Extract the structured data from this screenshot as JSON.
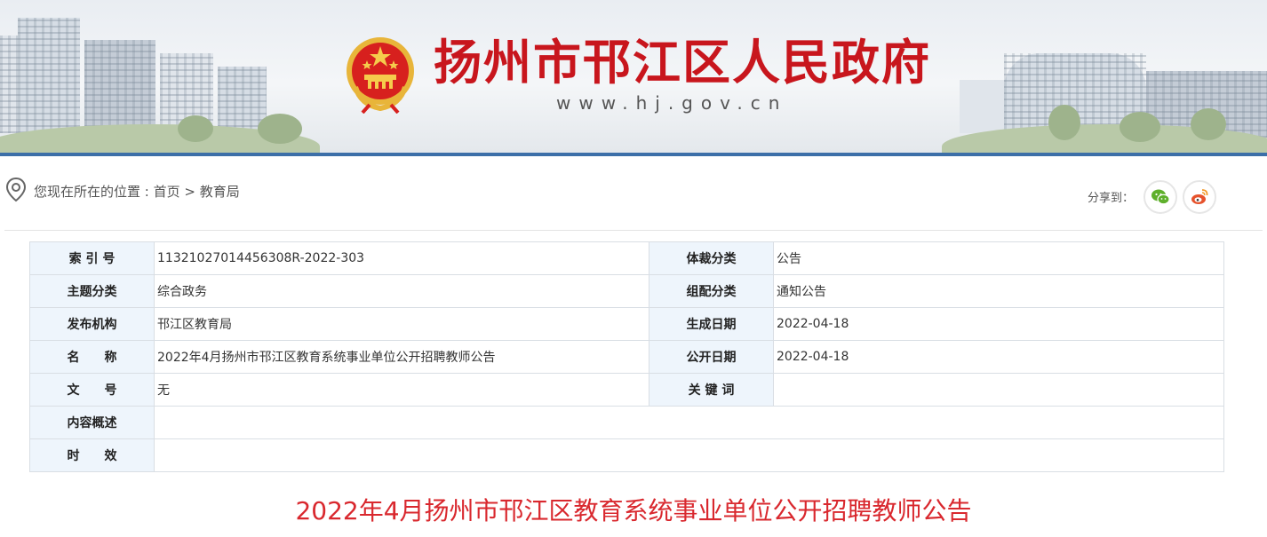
{
  "header": {
    "site_title": "扬州市邗江区人民政府",
    "site_url": "www.hj.gov.cn",
    "emblem_icon": "national-emblem-icon"
  },
  "breadcrumb": {
    "prefix": "您现在所在的位置 : ",
    "home": "首页",
    "separator": " > ",
    "current": "教育局"
  },
  "share": {
    "label": "分享到：",
    "wechat_icon": "wechat-icon",
    "weibo_icon": "weibo-icon"
  },
  "meta": {
    "rows": [
      {
        "k1": "索 引 号",
        "v1": "11321027014456308R-2022-303",
        "k2": "体裁分类",
        "v2": "公告"
      },
      {
        "k1": "主题分类",
        "v1": "综合政务",
        "k2": "组配分类",
        "v2": "通知公告"
      },
      {
        "k1": "发布机构",
        "v1": "邗江区教育局",
        "k2": "生成日期",
        "v2": "2022-04-18"
      },
      {
        "k1": "名　　称",
        "v1": "2022年4月扬州市邗江区教育系统事业单位公开招聘教师公告",
        "k2": "公开日期",
        "v2": "2022-04-18"
      },
      {
        "k1": "文　　号",
        "v1": "无",
        "k2": "关 键 词",
        "v2": ""
      }
    ],
    "summary_label": "内容概述",
    "summary_value": "",
    "validity_label": "时　　效",
    "validity_value": ""
  },
  "article": {
    "title": "2022年4月扬州市邗江区教育系统事业单位公开招聘教师公告"
  },
  "colors": {
    "title_red": "#c8161d",
    "article_red": "#d9282e",
    "key_cell_bg": "#eef5fc",
    "banner_line": "#3c6fa8"
  }
}
